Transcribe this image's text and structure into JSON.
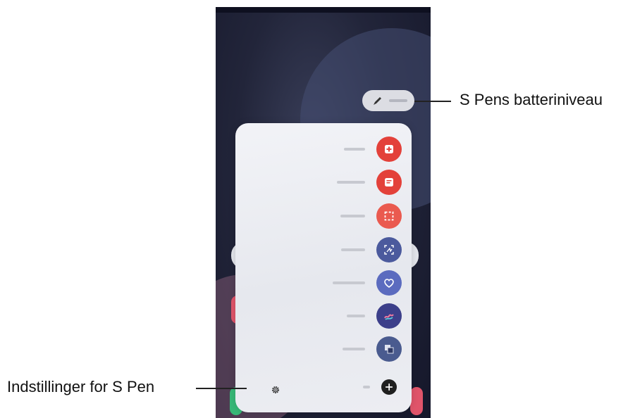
{
  "battery_label": "S Pens batteriniveau",
  "settings_label": "Indstillinger for S Pen",
  "menu_items": [
    {
      "icon": "create-note-icon",
      "color": "#e3413a"
    },
    {
      "icon": "view-all-notes-icon",
      "color": "#e3413a"
    },
    {
      "icon": "smart-select-icon",
      "color": "#ea5a4f"
    },
    {
      "icon": "screen-write-icon",
      "color": "#4b5a9d"
    },
    {
      "icon": "live-messages-icon",
      "color": "#5b6bbf"
    },
    {
      "icon": "ar-doodle-icon",
      "color": "#3c3f8a"
    },
    {
      "icon": "translate-icon",
      "color": "#4a5b8f"
    },
    {
      "icon": "add-shortcut-icon",
      "color": "#1f1f1f"
    }
  ],
  "colors": {
    "panel": "#eceef2",
    "callout_text": "#111111",
    "wallpaper": "#22253a"
  }
}
